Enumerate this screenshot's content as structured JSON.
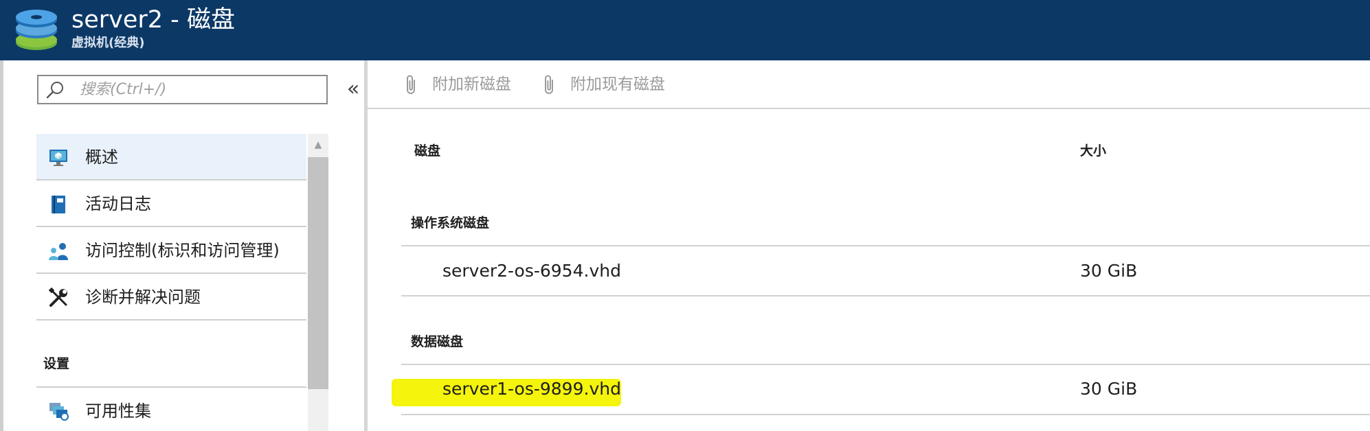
{
  "header": {
    "title": "server2 - 磁盘",
    "subtitle": "虚拟机(经典)",
    "icon": "virtual-disk-stack-icon",
    "background_color": "#0c3866"
  },
  "search": {
    "placeholder": "搜索(Ctrl+/)",
    "value": ""
  },
  "collapse_glyph": "«",
  "nav": {
    "items": [
      {
        "label": "概述",
        "icon": "overview-monitor-icon",
        "selected": true
      },
      {
        "label": "活动日志",
        "icon": "activity-log-book-icon",
        "selected": false
      },
      {
        "label": "访问控制(标识和访问管理)",
        "icon": "access-control-users-icon",
        "selected": false
      },
      {
        "label": "诊断并解决问题",
        "icon": "wrench-screwdriver-icon",
        "selected": false
      }
    ],
    "section_title": "设置",
    "section_items": [
      {
        "label": "可用性集",
        "icon": "availability-set-icon",
        "selected": false
      }
    ]
  },
  "toolbar": {
    "attach_new_label": "附加新磁盘",
    "attach_existing_label": "附加现有磁盘",
    "icon": "paperclip-icon"
  },
  "table": {
    "col_disk": "磁盘",
    "col_size": "大小",
    "os_group": "操作系统磁盘",
    "data_group": "数据磁盘",
    "os_disks": [
      {
        "name": "server2-os-6954.vhd",
        "size": "30 GiB"
      }
    ],
    "data_disks": [
      {
        "name": "server1-os-9899.vhd",
        "size": "30 GiB",
        "highlighted": true
      }
    ]
  },
  "colors": {
    "accent": "#0c3866",
    "selected_background": "#e9f1fb",
    "highlight": "#f4f40c",
    "icon_blue": "#1f6fb5"
  }
}
